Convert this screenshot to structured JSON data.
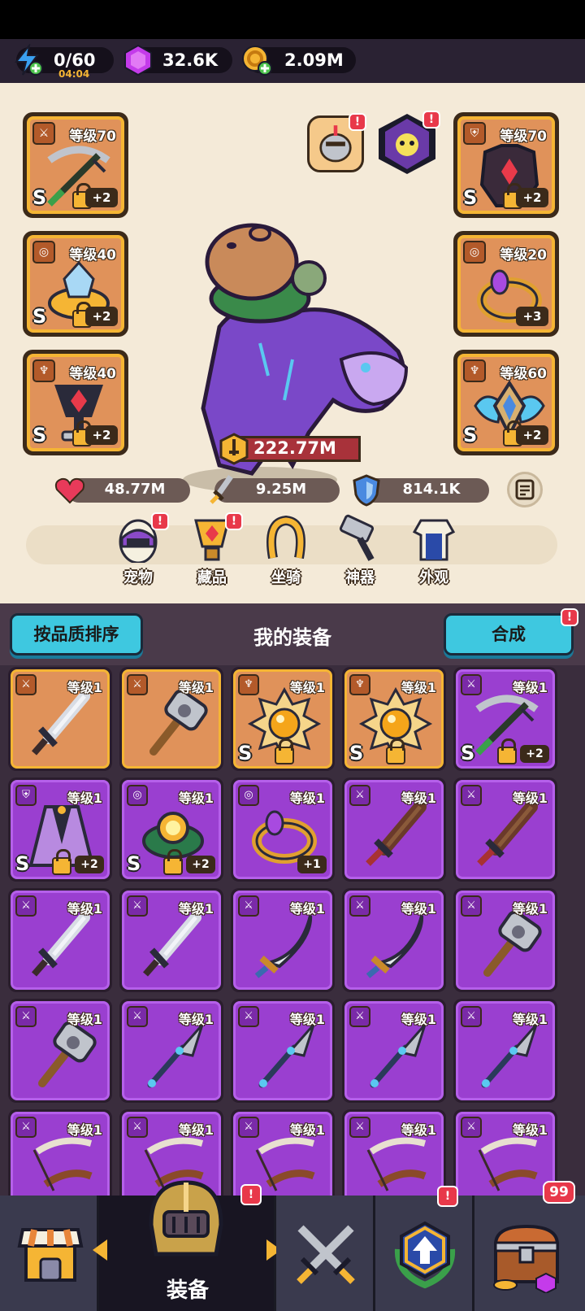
{
  "resources": {
    "energy": {
      "value": "0/60",
      "timer": "04:04"
    },
    "gems": {
      "value": "32.6K"
    },
    "gold": {
      "value": "2.09M"
    }
  },
  "equipped": {
    "left": [
      {
        "level": "等级70",
        "grade": "S",
        "plus": "+2",
        "type": "weapon",
        "icon": "crossbow-icon"
      },
      {
        "level": "等级40",
        "grade": "S",
        "plus": "+2",
        "type": "bracelet",
        "icon": "crystal-bracelet-icon"
      },
      {
        "level": "等级40",
        "grade": "S",
        "plus": "+2",
        "type": "necklace",
        "icon": "ruby-goblet-icon"
      }
    ],
    "right": [
      {
        "level": "等级70",
        "grade": "S",
        "plus": "+2",
        "type": "armor",
        "icon": "dark-armor-icon"
      },
      {
        "level": "等级20",
        "grade": "",
        "plus": "+3",
        "type": "ring",
        "icon": "amethyst-ring-icon"
      },
      {
        "level": "等级60",
        "grade": "S",
        "plus": "+2",
        "type": "necklace",
        "icon": "winged-crest-icon"
      }
    ]
  },
  "power": "222.77M",
  "stats": {
    "hp": "48.77M",
    "attack": "9.25M",
    "defense": "814.1K"
  },
  "menu": [
    {
      "label": "宠物",
      "icon": "pet-egg-icon",
      "badge": "!"
    },
    {
      "label": "藏品",
      "icon": "collection-trophy-icon",
      "badge": "!"
    },
    {
      "label": "坐骑",
      "icon": "mount-horseshoe-icon",
      "badge": ""
    },
    {
      "label": "神器",
      "icon": "artifact-hammer-icon",
      "badge": ""
    },
    {
      "label": "外观",
      "icon": "outfit-icon",
      "badge": ""
    }
  ],
  "inventory_header": {
    "sort_label": "按品质排序",
    "title": "我的装备",
    "merge_label": "合成",
    "merge_badge": "!"
  },
  "inventory": [
    {
      "level": "等级1",
      "rarity": "orange",
      "icon": "sword-icon",
      "grade": "",
      "plus": "",
      "lock": false,
      "type": "weapon"
    },
    {
      "level": "等级1",
      "rarity": "orange",
      "icon": "hammer-icon",
      "grade": "",
      "plus": "",
      "lock": false,
      "type": "weapon"
    },
    {
      "level": "等级1",
      "rarity": "orange",
      "icon": "sun-medal-icon",
      "grade": "S",
      "plus": "",
      "lock": true,
      "type": "necklace"
    },
    {
      "level": "等级1",
      "rarity": "orange",
      "icon": "sun-medal-icon",
      "grade": "S",
      "plus": "",
      "lock": true,
      "type": "necklace"
    },
    {
      "level": "等级1",
      "rarity": "purple",
      "icon": "crossbow-icon",
      "grade": "S",
      "plus": "+2",
      "lock": true,
      "type": "weapon"
    },
    {
      "level": "等级1",
      "rarity": "purple",
      "icon": "cloak-icon",
      "grade": "S",
      "plus": "+2",
      "lock": true,
      "type": "armor"
    },
    {
      "level": "等级1",
      "rarity": "purple",
      "icon": "jade-bracelet-icon",
      "grade": "S",
      "plus": "+2",
      "lock": true,
      "type": "bracelet"
    },
    {
      "level": "等级1",
      "rarity": "purple",
      "icon": "amethyst-ring-icon",
      "grade": "",
      "plus": "+1",
      "lock": false,
      "type": "bracelet"
    },
    {
      "level": "等级1",
      "rarity": "purple",
      "icon": "wooden-sword-icon",
      "grade": "",
      "plus": "",
      "lock": false,
      "type": "weapon"
    },
    {
      "level": "等级1",
      "rarity": "purple",
      "icon": "wooden-sword-icon",
      "grade": "",
      "plus": "",
      "lock": false,
      "type": "weapon"
    },
    {
      "level": "等级1",
      "rarity": "purple",
      "icon": "sword-icon",
      "grade": "",
      "plus": "",
      "lock": false,
      "type": "weapon"
    },
    {
      "level": "等级1",
      "rarity": "purple",
      "icon": "sword-icon",
      "grade": "",
      "plus": "",
      "lock": false,
      "type": "weapon"
    },
    {
      "level": "等级1",
      "rarity": "purple",
      "icon": "scimitar-icon",
      "grade": "",
      "plus": "",
      "lock": false,
      "type": "weapon"
    },
    {
      "level": "等级1",
      "rarity": "purple",
      "icon": "scimitar-icon",
      "grade": "",
      "plus": "",
      "lock": false,
      "type": "weapon"
    },
    {
      "level": "等级1",
      "rarity": "purple",
      "icon": "hammer-icon",
      "grade": "",
      "plus": "",
      "lock": false,
      "type": "weapon"
    },
    {
      "level": "等级1",
      "rarity": "purple",
      "icon": "hammer-icon",
      "grade": "",
      "plus": "",
      "lock": false,
      "type": "weapon"
    },
    {
      "level": "等级1",
      "rarity": "purple",
      "icon": "spear-icon",
      "grade": "",
      "plus": "",
      "lock": false,
      "type": "weapon"
    },
    {
      "level": "等级1",
      "rarity": "purple",
      "icon": "spear-icon",
      "grade": "",
      "plus": "",
      "lock": false,
      "type": "weapon"
    },
    {
      "level": "等级1",
      "rarity": "purple",
      "icon": "spear-icon",
      "grade": "",
      "plus": "",
      "lock": false,
      "type": "weapon"
    },
    {
      "level": "等级1",
      "rarity": "purple",
      "icon": "spear-icon",
      "grade": "",
      "plus": "",
      "lock": false,
      "type": "weapon"
    },
    {
      "level": "等级1",
      "rarity": "purple",
      "icon": "bow-icon",
      "grade": "",
      "plus": "",
      "lock": false,
      "type": "weapon"
    },
    {
      "level": "等级1",
      "rarity": "purple",
      "icon": "bow-icon",
      "grade": "",
      "plus": "",
      "lock": false,
      "type": "weapon"
    },
    {
      "level": "等级1",
      "rarity": "purple",
      "icon": "bow-icon",
      "grade": "",
      "plus": "",
      "lock": false,
      "type": "weapon"
    },
    {
      "level": "等级1",
      "rarity": "purple",
      "icon": "bow-icon",
      "grade": "",
      "plus": "",
      "lock": false,
      "type": "weapon"
    },
    {
      "level": "等级1",
      "rarity": "purple",
      "icon": "bow-icon",
      "grade": "",
      "plus": "",
      "lock": false,
      "type": "weapon"
    }
  ],
  "bottom_nav": {
    "items": [
      {
        "label": "",
        "icon": "shop-icon",
        "badge": ""
      },
      {
        "label": "装备",
        "icon": "helmet-icon",
        "badge": "!"
      },
      {
        "label": "",
        "icon": "crossed-swords-icon",
        "badge": ""
      },
      {
        "label": "",
        "icon": "upgrade-arrow-icon",
        "badge": "!"
      },
      {
        "label": "",
        "icon": "treasure-chest-icon",
        "badge": "99"
      }
    ]
  },
  "colors": {
    "orange_rarity": "#e0925a",
    "purple_rarity": "#9a3fd0",
    "accent_cyan": "#3ec8e0",
    "badge_red": "#e8384a",
    "gold": "#f5b534"
  }
}
